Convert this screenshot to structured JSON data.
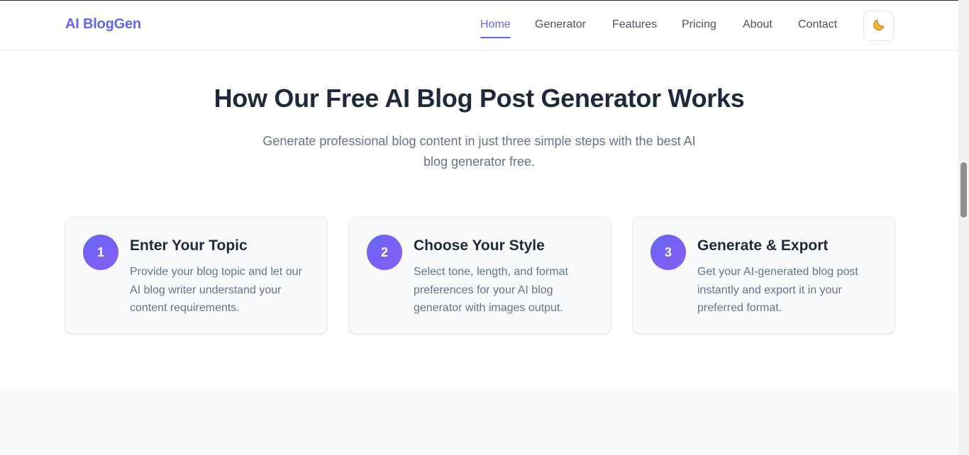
{
  "header": {
    "logo": "AI BlogGen",
    "nav": [
      {
        "label": "Home",
        "active": true
      },
      {
        "label": "Generator",
        "active": false
      },
      {
        "label": "Features",
        "active": false
      },
      {
        "label": "Pricing",
        "active": false
      },
      {
        "label": "About",
        "active": false
      },
      {
        "label": "Contact",
        "active": false
      }
    ],
    "theme_toggle_icon": "moon-icon"
  },
  "section": {
    "title": "How Our Free AI Blog Post Generator Works",
    "subtitle": "Generate professional blog content in just three simple steps with the best AI blog generator free."
  },
  "steps": [
    {
      "number": "1",
      "title": "Enter Your Topic",
      "description": "Provide your blog topic and let our AI blog writer understand your content requirements."
    },
    {
      "number": "2",
      "title": "Choose Your Style",
      "description": "Select tone, length, and format preferences for your AI blog generator with images output."
    },
    {
      "number": "3",
      "title": "Generate & Export",
      "description": "Get your AI-generated blog post instantly and export it in your preferred format."
    }
  ],
  "colors": {
    "accent": "#6366f1",
    "accent_secondary": "#8b5cf6",
    "heading": "#1e293b",
    "muted_text": "#64748b"
  }
}
